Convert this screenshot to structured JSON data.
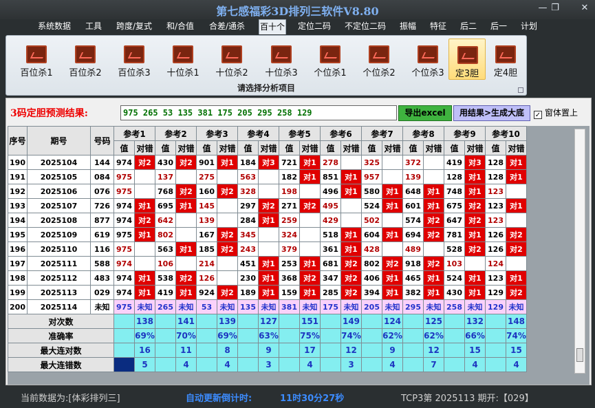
{
  "window": {
    "title": "第七感福彩3D排列三软件V8.80",
    "minimize": "—",
    "maximize": "❐",
    "close": "✕"
  },
  "menu": [
    "系统数据",
    "工具",
    "跨度/复式",
    "和/合值",
    "合差/通杀",
    "百十个",
    "定位二码",
    "不定位二码",
    "振幅",
    "特征",
    "后二",
    "后一",
    "计划"
  ],
  "menu_active": "百十个",
  "ribbon": {
    "buttons": [
      "百位杀1",
      "百位杀2",
      "百位杀3",
      "十位杀1",
      "十位杀2",
      "十位杀3",
      "个位杀1",
      "个位杀2",
      "个位杀3",
      "定3胆",
      "定4胆"
    ],
    "selected": "定3胆",
    "caption": "请选择分析项目",
    "icon": "chart-icon"
  },
  "result": {
    "label": "3码定胆预测结果:",
    "value": "975 265 53 135 381 175 205 295 258 129"
  },
  "buttons": {
    "export": "导出excel",
    "generate": "用结果>生成大底"
  },
  "ontop": {
    "label": "窗体置上",
    "checked": "✓"
  },
  "table": {
    "h_seq": "序号",
    "h_period": "期号",
    "h_code": "号码",
    "refs": [
      "参考1",
      "参考2",
      "参考3",
      "参考4",
      "参考5",
      "参考6",
      "参考7",
      "参考8",
      "参考9",
      "参考10"
    ],
    "sub_val": "值",
    "sub_hit": "对错",
    "rows": [
      {
        "seq": "190",
        "period": "2025104",
        "code": "144",
        "cells": [
          [
            "974",
            "对2"
          ],
          [
            "430",
            "对2"
          ],
          [
            "901",
            "对1"
          ],
          [
            "184",
            "对3"
          ],
          [
            "721",
            "对1"
          ],
          [
            "278",
            ""
          ],
          [
            "325",
            ""
          ],
          [
            "372",
            ""
          ],
          [
            "419",
            "对3"
          ],
          [
            "128",
            "对1"
          ]
        ]
      },
      {
        "seq": "191",
        "period": "2025105",
        "code": "084",
        "cells": [
          [
            "975",
            ""
          ],
          [
            "137",
            ""
          ],
          [
            "275",
            ""
          ],
          [
            "563",
            ""
          ],
          [
            "182",
            "对1"
          ],
          [
            "851",
            "对1"
          ],
          [
            "957",
            ""
          ],
          [
            "139",
            ""
          ],
          [
            "128",
            "对1"
          ],
          [
            "128",
            "对1"
          ]
        ]
      },
      {
        "seq": "192",
        "period": "2025106",
        "code": "076",
        "cells": [
          [
            "975",
            ""
          ],
          [
            "768",
            "对2"
          ],
          [
            "160",
            "对2"
          ],
          [
            "328",
            ""
          ],
          [
            "198",
            ""
          ],
          [
            "496",
            "对1"
          ],
          [
            "580",
            "对1"
          ],
          [
            "648",
            "对1"
          ],
          [
            "748",
            "对1"
          ],
          [
            "123",
            ""
          ]
        ]
      },
      {
        "seq": "193",
        "period": "2025107",
        "code": "726",
        "cells": [
          [
            "974",
            "对1"
          ],
          [
            "695",
            "对1"
          ],
          [
            "145",
            ""
          ],
          [
            "297",
            "对2"
          ],
          [
            "271",
            "对2"
          ],
          [
            "495",
            ""
          ],
          [
            "524",
            "对1"
          ],
          [
            "601",
            "对1"
          ],
          [
            "675",
            "对2"
          ],
          [
            "123",
            "对1"
          ]
        ]
      },
      {
        "seq": "194",
        "period": "2025108",
        "code": "877",
        "cells": [
          [
            "974",
            "对2"
          ],
          [
            "642",
            ""
          ],
          [
            "139",
            ""
          ],
          [
            "284",
            "对1"
          ],
          [
            "259",
            ""
          ],
          [
            "429",
            ""
          ],
          [
            "502",
            ""
          ],
          [
            "574",
            "对2"
          ],
          [
            "647",
            "对2"
          ],
          [
            "123",
            ""
          ]
        ]
      },
      {
        "seq": "195",
        "period": "2025109",
        "code": "619",
        "cells": [
          [
            "975",
            "对1"
          ],
          [
            "802",
            ""
          ],
          [
            "167",
            "对2"
          ],
          [
            "345",
            ""
          ],
          [
            "324",
            ""
          ],
          [
            "518",
            "对1"
          ],
          [
            "604",
            "对1"
          ],
          [
            "694",
            "对2"
          ],
          [
            "781",
            "对1"
          ],
          [
            "126",
            "对2"
          ]
        ]
      },
      {
        "seq": "196",
        "period": "2025110",
        "code": "116",
        "cells": [
          [
            "975",
            ""
          ],
          [
            "563",
            "对1"
          ],
          [
            "185",
            "对2"
          ],
          [
            "243",
            ""
          ],
          [
            "379",
            ""
          ],
          [
            "361",
            "对1"
          ],
          [
            "428",
            ""
          ],
          [
            "489",
            ""
          ],
          [
            "528",
            "对2"
          ],
          [
            "126",
            "对2"
          ]
        ]
      },
      {
        "seq": "197",
        "period": "2025111",
        "code": "588",
        "cells": [
          [
            "974",
            ""
          ],
          [
            "106",
            ""
          ],
          [
            "214",
            ""
          ],
          [
            "451",
            "对1"
          ],
          [
            "253",
            "对1"
          ],
          [
            "681",
            "对2"
          ],
          [
            "802",
            "对2"
          ],
          [
            "918",
            "对2"
          ],
          [
            "103",
            ""
          ],
          [
            "124",
            ""
          ]
        ]
      },
      {
        "seq": "198",
        "period": "2025112",
        "code": "483",
        "cells": [
          [
            "974",
            "对1"
          ],
          [
            "538",
            "对2"
          ],
          [
            "126",
            ""
          ],
          [
            "230",
            "对1"
          ],
          [
            "368",
            "对2"
          ],
          [
            "347",
            "对2"
          ],
          [
            "406",
            "对1"
          ],
          [
            "465",
            "对1"
          ],
          [
            "524",
            "对1"
          ],
          [
            "123",
            "对1"
          ]
        ]
      },
      {
        "seq": "199",
        "period": "2025113",
        "code": "029",
        "cells": [
          [
            "974",
            "对1"
          ],
          [
            "419",
            "对1"
          ],
          [
            "924",
            "对2"
          ],
          [
            "189",
            "对1"
          ],
          [
            "159",
            "对1"
          ],
          [
            "285",
            "对2"
          ],
          [
            "394",
            "对1"
          ],
          [
            "382",
            "对1"
          ],
          [
            "430",
            "对1"
          ],
          [
            "129",
            "对2"
          ]
        ]
      }
    ],
    "pred": {
      "seq": "200",
      "period": "2025114",
      "code": "未知",
      "cells": [
        "975",
        "265",
        "53",
        "135",
        "381",
        "175",
        "205",
        "295",
        "258",
        "129"
      ],
      "hit": "未知"
    },
    "stats": [
      {
        "label": "对次数",
        "values": [
          "138",
          "141",
          "139",
          "127",
          "151",
          "149",
          "124",
          "125",
          "132",
          "148"
        ]
      },
      {
        "label": "准确率",
        "values": [
          "69%",
          "70%",
          "69%",
          "63%",
          "75%",
          "74%",
          "62%",
          "62%",
          "66%",
          "74%"
        ]
      },
      {
        "label": "最大连对数",
        "values": [
          "16",
          "11",
          "8",
          "9",
          "17",
          "12",
          "9",
          "12",
          "15",
          "15"
        ]
      },
      {
        "label": "最大连错数",
        "values": [
          "5",
          "4",
          "4",
          "3",
          "4",
          "3",
          "4",
          "7",
          "4",
          "4"
        ]
      }
    ]
  },
  "status": {
    "current": "当前数据为:[体彩排列三]",
    "countdown_label": "自动更新倒计时:",
    "countdown": "11时30分27秒",
    "draw": "TCP3第 2025113 期开:【029】"
  },
  "colors": {
    "hit": "#e00000",
    "miss_text": "#b10000",
    "predict_row": "#fad2fa",
    "stats_row": "#84eef0",
    "export": "#3fb33f",
    "generate": "#bfbff8",
    "result_text": "#007000"
  }
}
